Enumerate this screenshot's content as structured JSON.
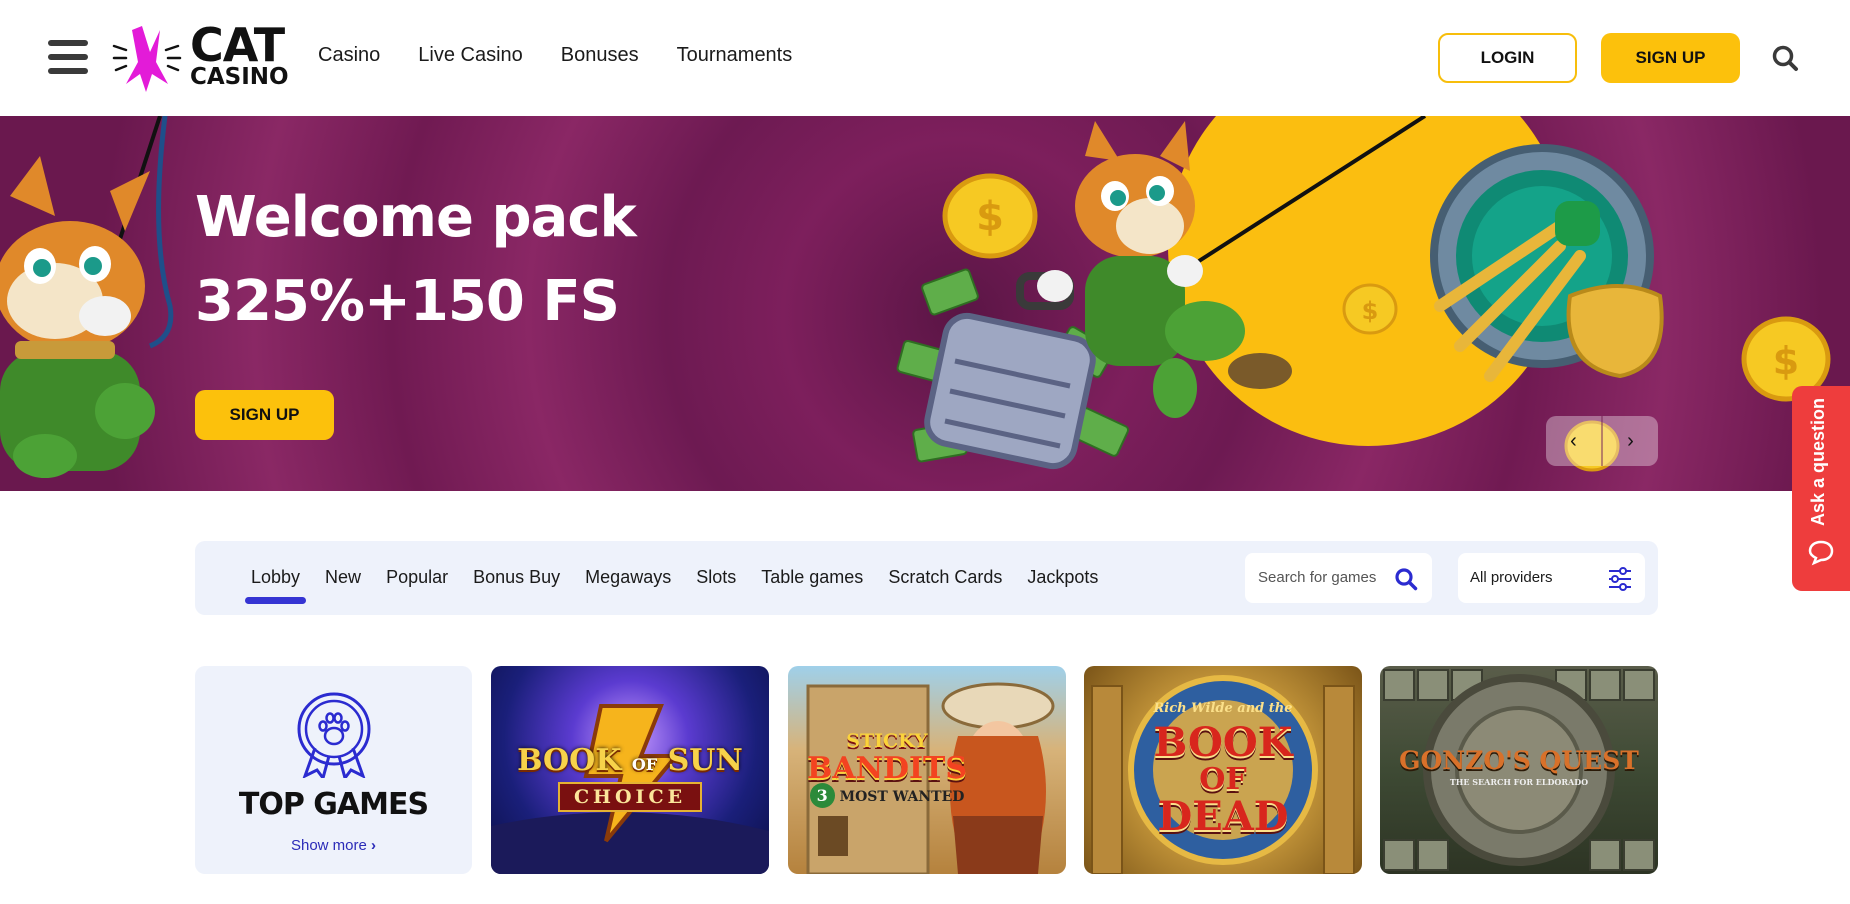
{
  "header": {
    "logo": {
      "line1": "CAT",
      "line2": "CASINO"
    },
    "nav": [
      "Casino",
      "Live Casino",
      "Bonuses",
      "Tournaments"
    ],
    "login_label": "LOGIN",
    "signup_label": "SIGN UP"
  },
  "hero": {
    "title_line1": "Welcome pack",
    "title_line2": "325%+150 FS",
    "signup_label": "SIGN UP"
  },
  "ask": {
    "label": "Ask a question"
  },
  "filters": {
    "tabs": [
      "Lobby",
      "New",
      "Popular",
      "Bonus Buy",
      "Megaways",
      "Slots",
      "Table games",
      "Scratch Cards",
      "Jackpots"
    ],
    "active_tab": "Lobby",
    "search_placeholder": "Search for games",
    "providers_value": "All providers"
  },
  "games": {
    "top_games": {
      "title": "TOP GAMES",
      "more": "Show more"
    },
    "tiles": [
      {
        "name": "Book of Sun Choice",
        "line1": "BOOK",
        "line2": "OF",
        "line3": "SUN",
        "line4": "CHOICE"
      },
      {
        "name": "Sticky Bandits 3 Most Wanted",
        "line1": "STICKY",
        "line2": "BANDITS",
        "line3": "3",
        "line4": "MOST WANTED"
      },
      {
        "name": "Book of Dead",
        "line1": "Rich Wilde and the",
        "line2": "BOOK",
        "line3": "OF",
        "line4": "DEAD"
      },
      {
        "name": "Gonzo's Quest",
        "line1": "GONZO'S QUEST",
        "line2": "THE SEARCH FOR ELDORADO"
      }
    ]
  },
  "colors": {
    "accent_yellow": "#fcc10c",
    "hero_purple": "#7d1f5c",
    "tab_underline": "#3534d3",
    "ask_red": "#ee3d3d",
    "logo_magenta": "#e31bd8"
  }
}
